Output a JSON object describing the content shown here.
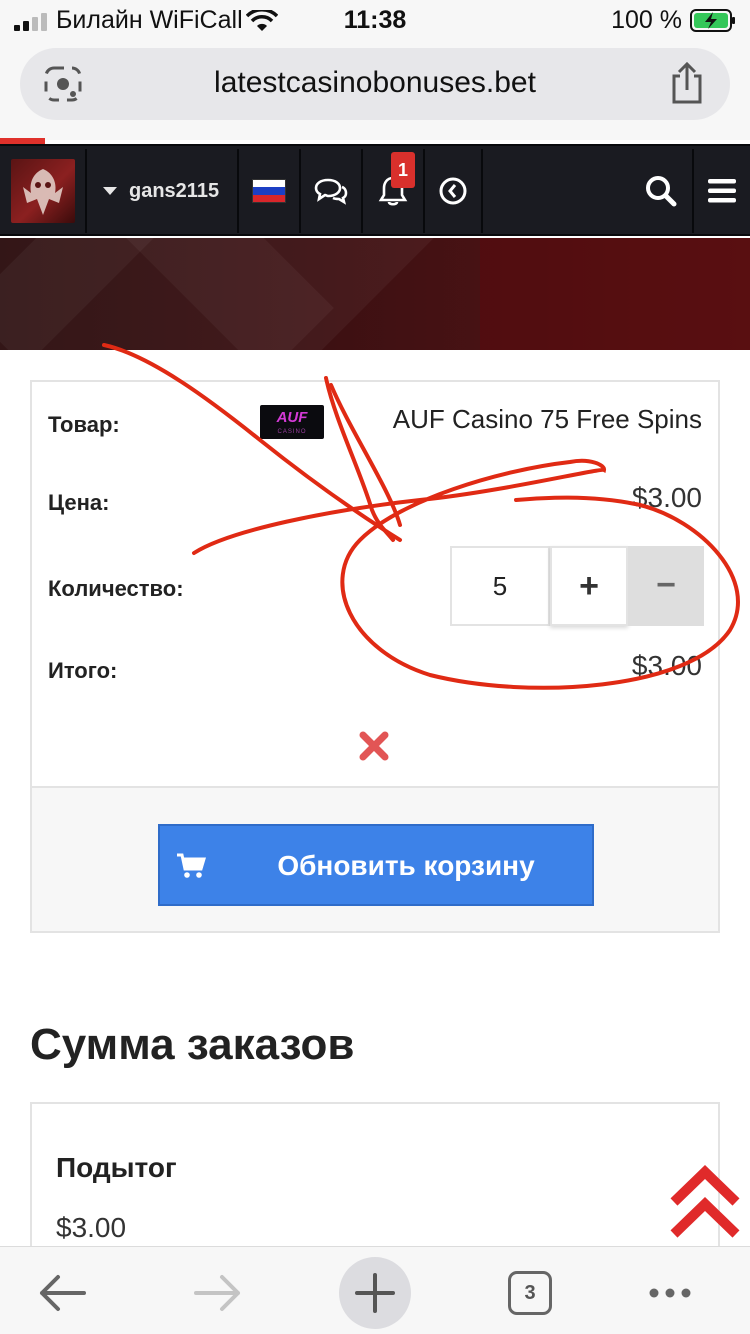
{
  "status_bar": {
    "carrier": "Билайн WiFiCall",
    "time": "11:38",
    "battery": "100 %"
  },
  "browser": {
    "url": "latestcasinobonuses.bet",
    "open_tabs": "3"
  },
  "site_header": {
    "username": "gans2115",
    "notification_count": "1",
    "language_flag": "russia-flag-icon"
  },
  "cart": {
    "product_label": "Товар:",
    "product_logo_text": "AUF",
    "product_logo_subtext": "CASINO",
    "product_name": "AUF Casino 75 Free Spins",
    "price_label": "Цена:",
    "price": "$3.00",
    "quantity_label": "Количество:",
    "quantity": "5",
    "plus_label": "+",
    "minus_label": "−",
    "total_label": "Итого:",
    "total": "$3.00",
    "update_button_label": "Обновить корзину"
  },
  "summary": {
    "title": "Сумма заказов",
    "subtotal_label": "Подытог",
    "subtotal": "$3.00"
  },
  "colors": {
    "header_bg": "#1a1b21",
    "accent_red": "#e0312b",
    "button_blue": "#3d82e8",
    "annotation_red": "#e02a14"
  }
}
